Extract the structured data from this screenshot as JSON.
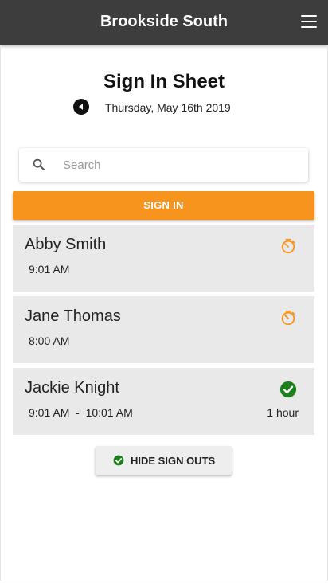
{
  "appbar": {
    "title": "Brookside South"
  },
  "sheet": {
    "title": "Sign In Sheet",
    "date": "Thursday, May 16th 2019"
  },
  "search": {
    "placeholder": "Search",
    "value": ""
  },
  "actions": {
    "sign_in_label": "SIGN IN",
    "hide_sign_outs_label": "HIDE SIGN OUTS"
  },
  "entries": [
    {
      "name": "Abby Smith",
      "time": "9:01 AM",
      "status_icon": "timer-icon"
    },
    {
      "name": "Jane Thomas",
      "time": "8:00 AM",
      "status_icon": "timer-icon"
    },
    {
      "name": "Jackie Knight",
      "time": "9:01 AM  -  10:01 AM",
      "duration": "1 hour",
      "status_icon": "check-circle-icon"
    }
  ],
  "colors": {
    "appbar": "#3d3d3d",
    "accent": "#f7941d",
    "signed_out": "#1b7f1b",
    "card": "#e9e9e9"
  }
}
